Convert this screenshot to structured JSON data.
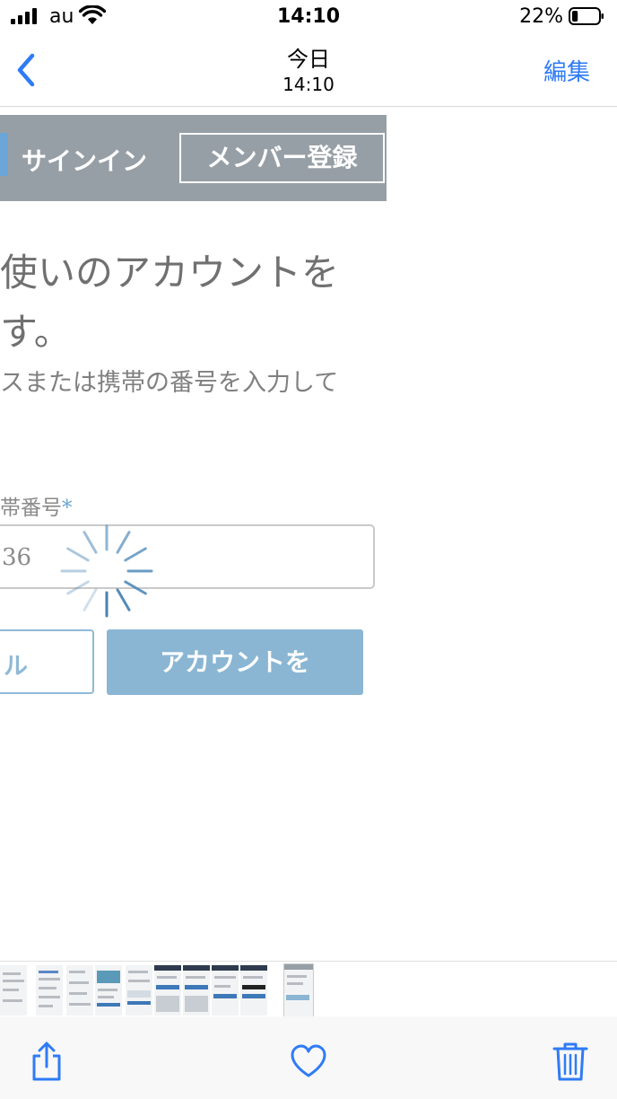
{
  "status_bar": {
    "carrier": "au",
    "time": "14:10",
    "battery_percent": "22%",
    "battery_level": 0.22
  },
  "nav": {
    "title": "今日",
    "subtitle": "14:10",
    "edit_label": "編集",
    "accent_color": "#2f7bf6"
  },
  "photo": {
    "header": {
      "signin_label": "サインイン",
      "register_label": "メンバー登録"
    },
    "heading_line1": "使いのアカウントを",
    "heading_line2": "す。",
    "instruction": "スまたは携帯の番号を入力して",
    "field_label": "帯番号",
    "field_required_mark": "*",
    "field_value": "36",
    "cancel_label": "ル",
    "create_label": "アカウントを"
  },
  "icons": {
    "back": "chevron-left-icon",
    "share": "share-icon",
    "favorite": "heart-icon",
    "delete": "trash-icon",
    "loading": "spinner-icon"
  }
}
